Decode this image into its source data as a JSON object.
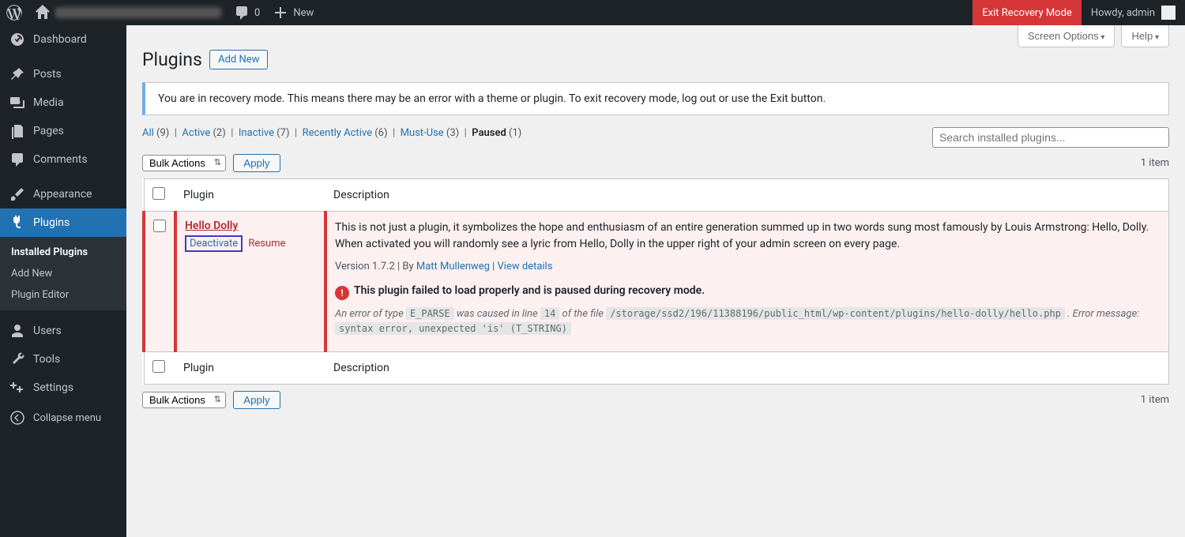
{
  "adminbar": {
    "comments_count": "0",
    "new_label": "New",
    "exit_label": "Exit Recovery Mode",
    "howdy": "Howdy, admin"
  },
  "sidebar": {
    "items": [
      {
        "label": "Dashboard"
      },
      {
        "label": "Posts"
      },
      {
        "label": "Media"
      },
      {
        "label": "Pages"
      },
      {
        "label": "Comments"
      },
      {
        "label": "Appearance"
      },
      {
        "label": "Plugins"
      },
      {
        "label": "Users"
      },
      {
        "label": "Tools"
      },
      {
        "label": "Settings"
      }
    ],
    "submenu": [
      {
        "label": "Installed Plugins"
      },
      {
        "label": "Add New"
      },
      {
        "label": "Plugin Editor"
      }
    ],
    "collapse": "Collapse menu"
  },
  "screen_meta": {
    "screen_options": "Screen Options",
    "help": "Help"
  },
  "header": {
    "title": "Plugins",
    "add_new": "Add New"
  },
  "notice": {
    "text": "You are in recovery mode. This means there may be an error with a theme or plugin. To exit recovery mode, log out or use the Exit button."
  },
  "filters": {
    "all": {
      "label": "All",
      "count": "(9)"
    },
    "active": {
      "label": "Active",
      "count": "(2)"
    },
    "inactive": {
      "label": "Inactive",
      "count": "(7)"
    },
    "recently_active": {
      "label": "Recently Active",
      "count": "(6)"
    },
    "must_use": {
      "label": "Must-Use",
      "count": "(3)"
    },
    "paused": {
      "label": "Paused",
      "count": "(1)"
    }
  },
  "search": {
    "placeholder": "Search installed plugins..."
  },
  "bulk": {
    "select": "Bulk Actions",
    "apply": "Apply"
  },
  "items_count": "1 item",
  "table": {
    "col_plugin": "Plugin",
    "col_desc": "Description"
  },
  "plugin": {
    "name": "Hello Dolly",
    "actions": {
      "deactivate": "Deactivate",
      "resume": "Resume"
    },
    "description": "This is not just a plugin, it symbolizes the hope and enthusiasm of an entire generation summed up in two words sung most famously by Louis Armstrong: Hello, Dolly. When activated you will randomly see a lyric from Hello, Dolly in the upper right of your admin screen on every page.",
    "meta": {
      "version_by": "Version 1.7.2 | By ",
      "author": "Matt Mullenweg",
      "sep": " | ",
      "view_details": "View details"
    },
    "error_msg": "This plugin failed to load properly and is paused during recovery mode.",
    "error_detail": {
      "p1": "An error of type ",
      "c1": "E_PARSE",
      "p2": " was caused in line ",
      "c2": "14",
      "p3": " of the file ",
      "c3": "/storage/ssd2/196/11388196/public_html/wp-content/plugins/hello-dolly/hello.php",
      "p4": " . Error message: ",
      "c4": "syntax error, unexpected 'is' (T_STRING)"
    }
  }
}
